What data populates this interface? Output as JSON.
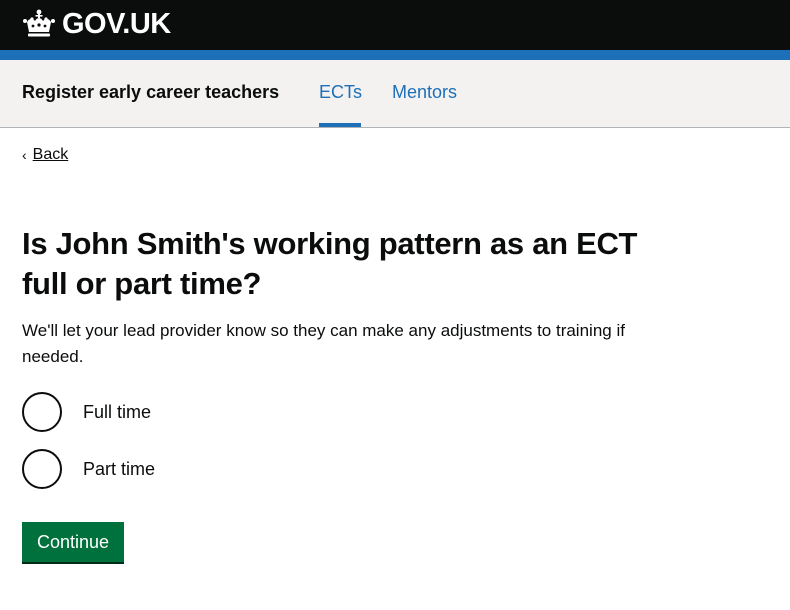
{
  "header": {
    "logotype": "GOV.UK",
    "crown_icon": "crown-icon",
    "bar_color": "#0b0c0c",
    "accent_color": "#1d70b8"
  },
  "service_nav": {
    "service_name": "Register early career teachers",
    "links": [
      {
        "label": "ECTs",
        "active": true
      },
      {
        "label": "Mentors",
        "active": false
      }
    ]
  },
  "back_link": {
    "label": "Back",
    "icon": "chevron-left-icon"
  },
  "question": {
    "title": "Is John Smith's working pattern as an ECT full or part time?",
    "hint": "We'll let your lead provider know so they can make any adjustments to training if needed."
  },
  "options": [
    {
      "label": "Full time",
      "selected": false
    },
    {
      "label": "Part time",
      "selected": false
    }
  ],
  "continue_button": {
    "label": "Continue",
    "color": "#00703c"
  }
}
